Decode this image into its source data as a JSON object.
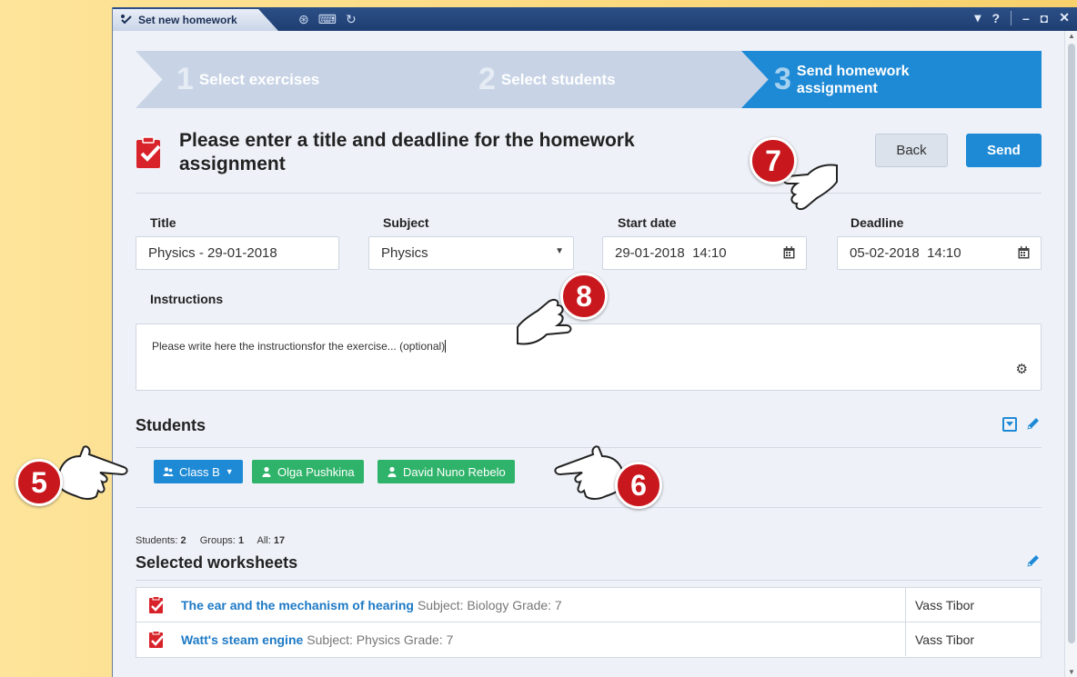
{
  "window": {
    "tab_title": "Set new homework"
  },
  "steps": [
    {
      "num": "1",
      "label": "Select exercises"
    },
    {
      "num": "2",
      "label": "Select students"
    },
    {
      "num": "3",
      "label": "Send homework assignment"
    }
  ],
  "header": {
    "title": "Please enter a title and deadline for the homework assignment",
    "back_label": "Back",
    "send_label": "Send"
  },
  "form": {
    "title_label": "Title",
    "title_value": "Physics - 29-01-2018",
    "subject_label": "Subject",
    "subject_value": "Physics",
    "start_label": "Start date",
    "start_value": "29-01-2018  14:10",
    "deadline_label": "Deadline",
    "deadline_value": "05-02-2018  14:10",
    "instructions_label": "Instructions",
    "instructions_value": "Please write here the instructionsfor the exercise... (optional)"
  },
  "students": {
    "heading": "Students",
    "chips": [
      {
        "label": "Class B",
        "type": "group",
        "color": "#1e8ad6"
      },
      {
        "label": "Olga Pushkina",
        "type": "student",
        "color": "#2fb36a"
      },
      {
        "label": "David Nuno Rebelo",
        "type": "student",
        "color": "#2fb36a"
      }
    ],
    "stats": {
      "students_label": "Students:",
      "students_count": "2",
      "groups_label": "Groups:",
      "groups_count": "1",
      "all_label": "All:",
      "all_count": "17"
    }
  },
  "worksheets": {
    "heading": "Selected worksheets",
    "rows": [
      {
        "title": "The ear and the mechanism of hearing",
        "meta": "Subject: Biology Grade: 7",
        "author": "Vass Tibor"
      },
      {
        "title": "Watt's steam engine",
        "meta": "Subject: Physics Grade: 7",
        "author": "Vass Tibor"
      }
    ]
  },
  "callouts": [
    "7",
    "8",
    "5",
    "6"
  ],
  "colors": {
    "accent": "#1e8ad6",
    "green": "#2fb36a",
    "badge": "#c8181e"
  }
}
